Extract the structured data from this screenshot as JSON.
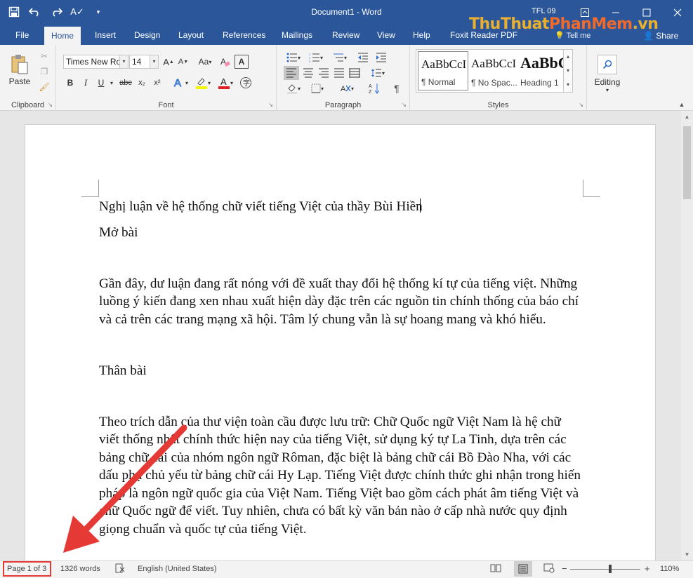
{
  "window": {
    "title": "Document1 - Word",
    "user": "TFL 09",
    "accent": "#2b579a"
  },
  "qat": {
    "icons": [
      "save-icon",
      "undo-icon",
      "redo-icon",
      "spelling-icon",
      "customize-qat-icon"
    ]
  },
  "tabs": [
    "File",
    "Home",
    "Insert",
    "Design",
    "Layout",
    "References",
    "Mailings",
    "Review",
    "View",
    "Help",
    "Foxit Reader PDF"
  ],
  "active_tab": "Home",
  "tell_me": "Tell me",
  "share": "Share",
  "watermark": {
    "part1": "ThuThuat",
    "part2": "PhanMem",
    "part3": ".vn"
  },
  "ribbon": {
    "clipboard": {
      "paste_label": "Paste",
      "group_label": "Clipboard"
    },
    "font": {
      "font_name": "Times New Ro",
      "font_size": "14",
      "group_label": "Font",
      "buttons": {
        "bold": "B",
        "italic": "I",
        "underline": "U",
        "strike": "abc",
        "subscript": "x₂",
        "superscript": "x²",
        "case": "Aa",
        "grow": "A",
        "shrink": "A"
      }
    },
    "paragraph": {
      "group_label": "Paragraph",
      "pilcrow": "¶"
    },
    "styles": {
      "group_label": "Styles",
      "items": [
        {
          "preview": "AaBbCcI",
          "name": "¶ Normal"
        },
        {
          "preview": "AaBbCcI",
          "name": "¶ No Spac..."
        },
        {
          "preview": "AaBbC",
          "name": "Heading 1"
        }
      ]
    },
    "editing": {
      "label": "Editing"
    }
  },
  "document": {
    "paragraphs": [
      "Nghị luận về hệ thống chữ viết tiếng Việt của thầy Bùi Hiền",
      "Mở bài",
      "",
      "Gần đây, dư luận đang rất nóng với đề xuất thay đổi hệ thống kí tự của tiếng việt. Những luồng ý kiến đang xen nhau xuất hiện dày đặc trên các nguồn tin chính thống của báo chí và cả trên các trang mạng xã hội. Tâm lý chung vẫn là sự hoang mang và khó hiểu.",
      "",
      "Thân bài",
      "",
      "Theo trích dẫn của thư viện toàn cầu được lưu trữ: Chữ Quốc ngữ Việt Nam là hệ chữ viết thống nhất chính thức hiện nay của tiếng Việt, sử dụng ký tự La Tinh, dựa trên các bảng chữ cái của nhóm ngôn ngữ Rôman, đặc biệt là bảng chữ cái Bồ Đào Nha, với các dấu phụ chủ yếu từ bảng chữ cái Hy Lạp. Tiếng Việt được chính thức ghi nhận trong hiến pháp là ngôn ngữ quốc gia của Việt Nam. Tiếng Việt bao gồm cách phát âm tiếng Việt và chữ Quốc ngữ để viết. Tuy nhiên, chưa có bất kỳ văn bản nào ở cấp nhà nước quy định giọng chuẩn và quốc tự của tiếng Việt."
    ]
  },
  "status": {
    "page": "Page 1 of 3",
    "words": "1326 words",
    "language": "English (United States)",
    "zoom": "110%",
    "zoom_minus": "−",
    "zoom_plus": "+",
    "highlight_color": "#e53935"
  }
}
